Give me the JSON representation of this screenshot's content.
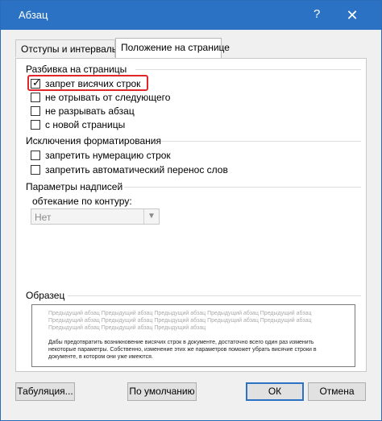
{
  "window": {
    "title": "Абзац",
    "help_label": "?",
    "close_label": "✕"
  },
  "tabs": [
    {
      "label": "Отступы и интервалы",
      "active": false
    },
    {
      "label": "Положение на странице",
      "active": true
    }
  ],
  "pagination": {
    "heading": "Разбивка на страницы",
    "options": [
      {
        "label": "запрет висячих строк",
        "checked": true
      },
      {
        "label": "не отрывать от следующего",
        "checked": false
      },
      {
        "label": "не разрывать абзац",
        "checked": false
      },
      {
        "label": "с новой страницы",
        "checked": false
      }
    ]
  },
  "formatting": {
    "heading": "Исключения форматирования",
    "options": [
      {
        "label": "запретить нумерацию строк",
        "checked": false
      },
      {
        "label": "запретить автоматический перенос слов",
        "checked": false
      }
    ]
  },
  "textbox": {
    "heading": "Параметры надписей",
    "wrap_label": "обтекание по контуру:",
    "wrap_value": "Нет"
  },
  "preview": {
    "heading": "Образец",
    "previous_text": "Предыдущий абзац Предыдущий абзац Предыдущий абзац Предыдущий абзац Предыдущий абзац Предыдущий абзац Предыдущий абзац Предыдущий абзац Предыдущий абзац Предыдущий абзац Предыдущий абзац Предыдущий абзац Предыдущий абзац",
    "sample_text": "Дабы предотвратить возникновение висячих строк в документе, достаточно всего один раз изменить некоторые параметры. Собственно, изменение этих же параметров поможет убрать висячие строки в документе, в котором они уже имеются."
  },
  "buttons": {
    "tabs_label": "Табуляция...",
    "default_label": "По умолчанию",
    "ok_label": "ОК",
    "cancel_label": "Отмена"
  }
}
